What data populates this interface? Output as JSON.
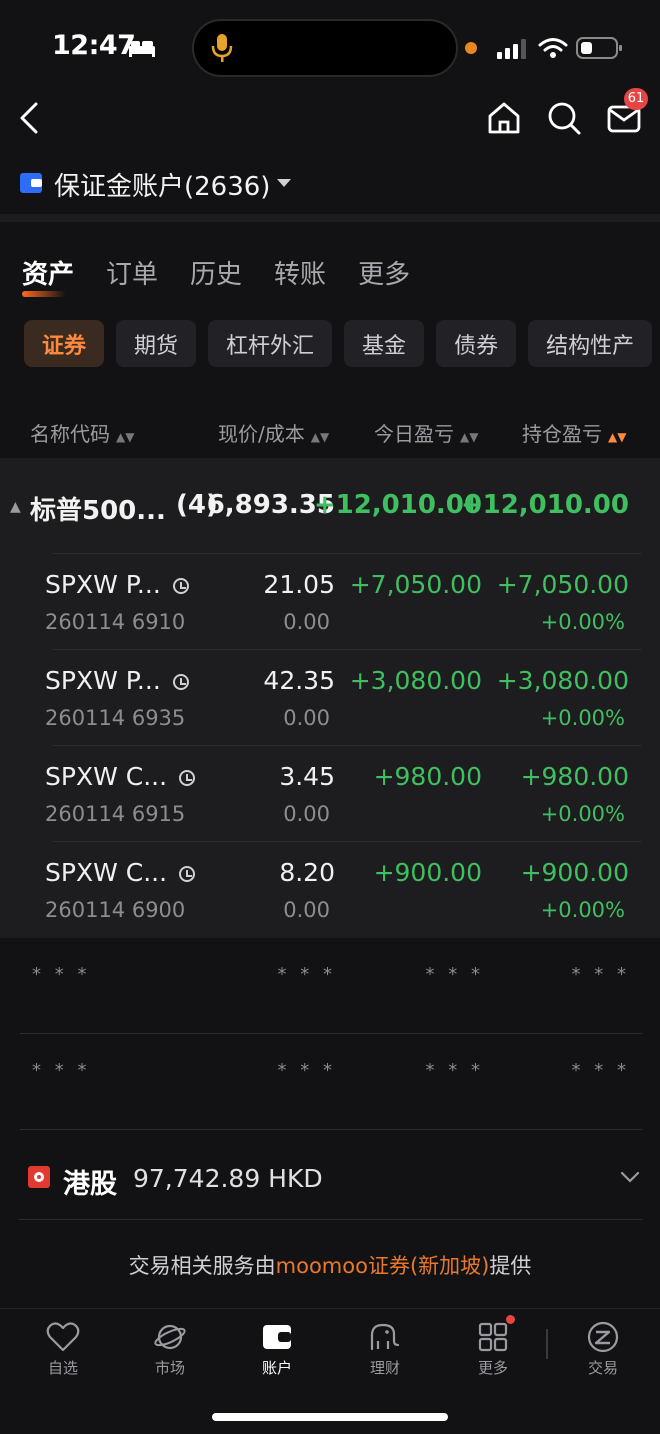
{
  "status_bar": {
    "time": "12:47"
  },
  "header": {
    "mail_badge": "61"
  },
  "account": {
    "label": "保证金账户(2636)"
  },
  "tabs": [
    {
      "label": "资产",
      "active": true
    },
    {
      "label": "订单",
      "active": false
    },
    {
      "label": "历史",
      "active": false
    },
    {
      "label": "转账",
      "active": false
    },
    {
      "label": "更多",
      "active": false
    }
  ],
  "chips": [
    {
      "label": "证券",
      "active": true
    },
    {
      "label": "期货",
      "active": false
    },
    {
      "label": "杠杆外汇",
      "active": false
    },
    {
      "label": "基金",
      "active": false
    },
    {
      "label": "债券",
      "active": false
    },
    {
      "label": "结构性产",
      "active": false
    }
  ],
  "columns": {
    "name": "名称代码",
    "price": "现价/成本",
    "today_pl": "今日盈亏",
    "position_pl": "持仓盈亏"
  },
  "group": {
    "name": "标普500...",
    "count": "(4)",
    "price": "6,893.35",
    "today_pl": "+12,010.00",
    "position_pl": "+12,010.00"
  },
  "positions": [
    {
      "name": "SPXW P...",
      "code": "260114 6910",
      "price": "21.05",
      "cost": "0.00",
      "today_pl": "+7,050.00",
      "position_pl": "+7,050.00",
      "position_pct": "+0.00%"
    },
    {
      "name": "SPXW P...",
      "code": "260114 6935",
      "price": "42.35",
      "cost": "0.00",
      "today_pl": "+3,080.00",
      "position_pl": "+3,080.00",
      "position_pct": "+0.00%"
    },
    {
      "name": "SPXW C...",
      "code": "260114 6915",
      "price": "3.45",
      "cost": "0.00",
      "today_pl": "+980.00",
      "position_pl": "+980.00",
      "position_pct": "+0.00%"
    },
    {
      "name": "SPXW C...",
      "code": "260114 6900",
      "price": "8.20",
      "cost": "0.00",
      "today_pl": "+900.00",
      "position_pl": "+900.00",
      "position_pct": "+0.00%"
    }
  ],
  "hidden_rows": [
    {
      "a": "* * *",
      "b": "* * *",
      "c": "* * *",
      "d": "* * *"
    },
    {
      "a": "* * *",
      "b": "* * *",
      "c": "* * *",
      "d": "* * *"
    }
  ],
  "hk": {
    "label": "港股",
    "value": "97,742.89 HKD"
  },
  "footer": {
    "prefix": "交易相关服务由",
    "brand": "moomoo证券(新加坡)",
    "suffix": "提供"
  },
  "bottom_nav": [
    {
      "label": "自选"
    },
    {
      "label": "市场"
    },
    {
      "label": "账户"
    },
    {
      "label": "理财"
    },
    {
      "label": "更多"
    },
    {
      "label": "交易"
    }
  ],
  "colors": {
    "positive": "#3fbf5f",
    "accent": "#ff8a3d",
    "brand_link": "#e8782a"
  }
}
